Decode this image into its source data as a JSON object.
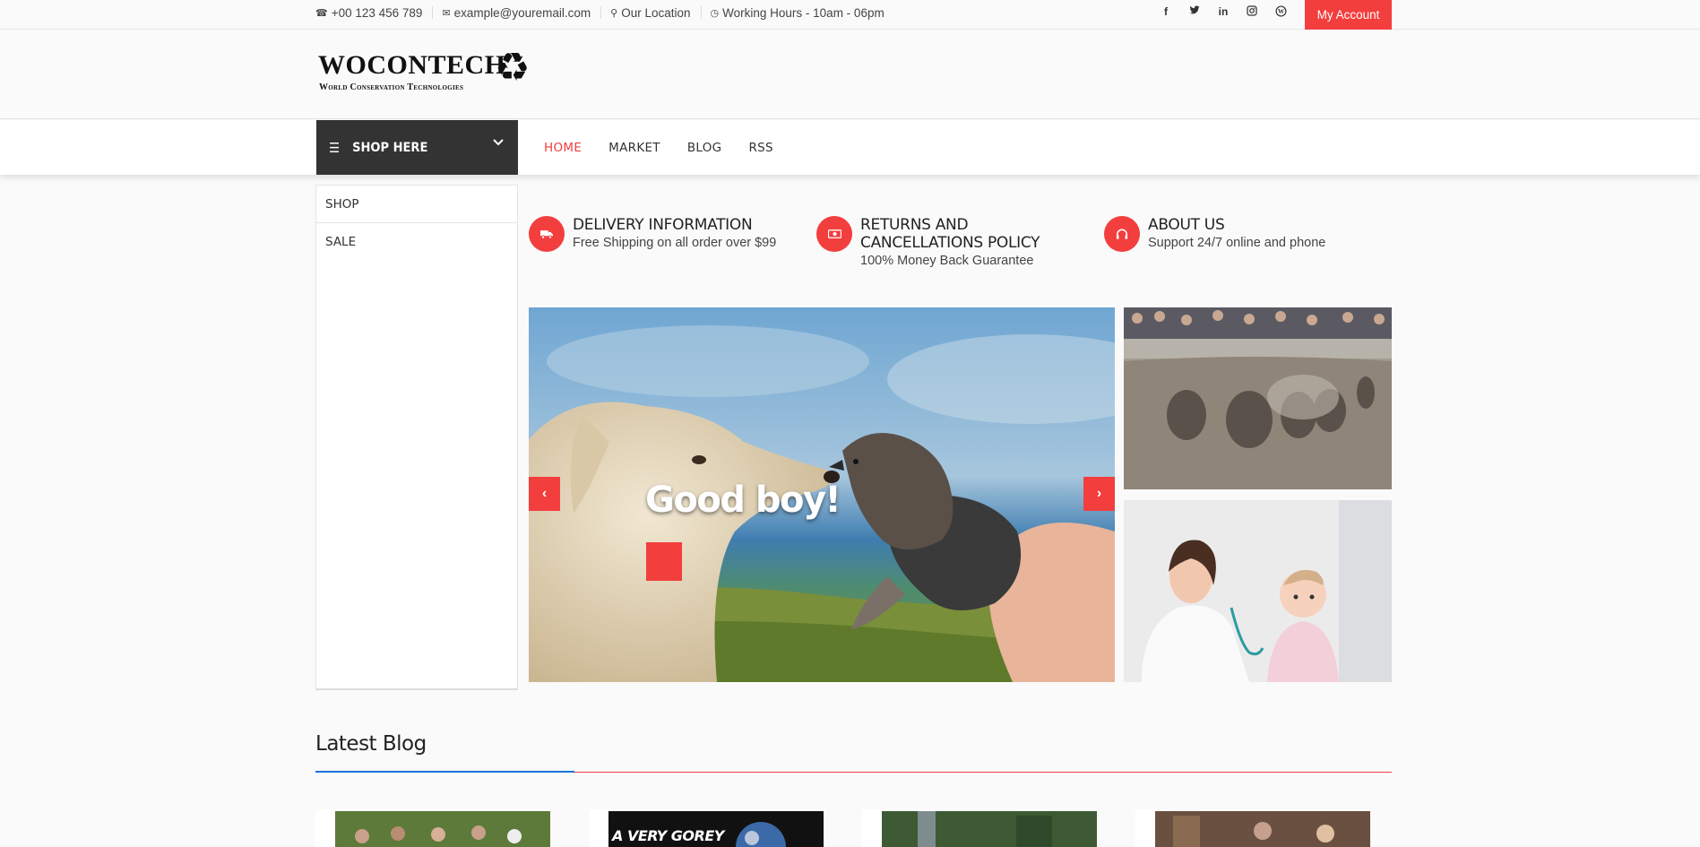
{
  "topbar": {
    "phone": "+00 123 456 789",
    "email": "example@youremail.com",
    "location": "Our Location",
    "hours": "Working Hours - 10am - 06pm",
    "social_icons": [
      "facebook-icon",
      "twitter-icon",
      "linkedin-icon",
      "instagram-icon",
      "wordpress-icon"
    ],
    "account_label": "My Account"
  },
  "logo": {
    "name": "WOCONTECH",
    "tagline": "World Conservation Technologies"
  },
  "nav": {
    "shop_here": "SHOP HERE",
    "links": [
      "HOME",
      "MARKET",
      "BLOG",
      "RSS"
    ],
    "active": "HOME"
  },
  "categories": [
    "SHOP",
    "SALE"
  ],
  "features": [
    {
      "icon": "truck-icon",
      "title": "DELIVERY INFORMATION",
      "desc": "Free Shipping on all order over $99"
    },
    {
      "icon": "money-icon",
      "title": "RETURNS AND CANCELLATIONS POLICY",
      "desc": "100% Money Back Guarantee"
    },
    {
      "icon": "headphones-icon",
      "title": "ABOUT US",
      "desc": "Support 24/7 online and phone"
    }
  ],
  "slider": {
    "headline": "Good boy!"
  },
  "blog": {
    "title": "Latest Blog",
    "card2_caption": "A VERY GOREY"
  },
  "colors": {
    "accent": "#f33e3e",
    "dark": "#333333",
    "blue": "#1a73d9"
  }
}
